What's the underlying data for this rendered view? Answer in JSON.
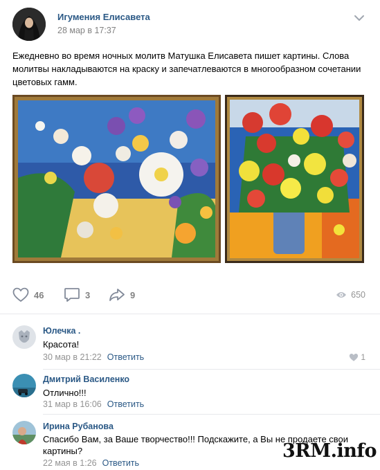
{
  "post": {
    "author": "Игумения Елисавета",
    "date": "28 мар в 17:37",
    "text": "Ежедневно во время ночных молитв Матушка Елисавета пишет картины. Слова молитвы накладываются на краску и запечатлеваются в многообразном сочетании цветовых гамм."
  },
  "actions": {
    "likes": "46",
    "comments": "3",
    "shares": "9",
    "views": "650"
  },
  "comments": [
    {
      "name": "Юлечка .",
      "text": "Красота!",
      "date": "30 мар в 21:22",
      "reply": "Ответить",
      "likes": "1"
    },
    {
      "name": "Дмитрий Василенко",
      "text": "Отлично!!!",
      "date": "31 мар в 16:06",
      "reply": "Ответить"
    },
    {
      "name": "Ирина Рубанова",
      "text": "Спасибо Вам, за Ваше творчество!!! Подскажите, а Вы не продаете свои картины?",
      "date": "22 мая в 1:26",
      "reply": "Ответить"
    }
  ],
  "watermark": "3RM.info",
  "colors": {
    "link": "#2a5885",
    "muted": "#828282",
    "frame": "#6b4a22"
  }
}
